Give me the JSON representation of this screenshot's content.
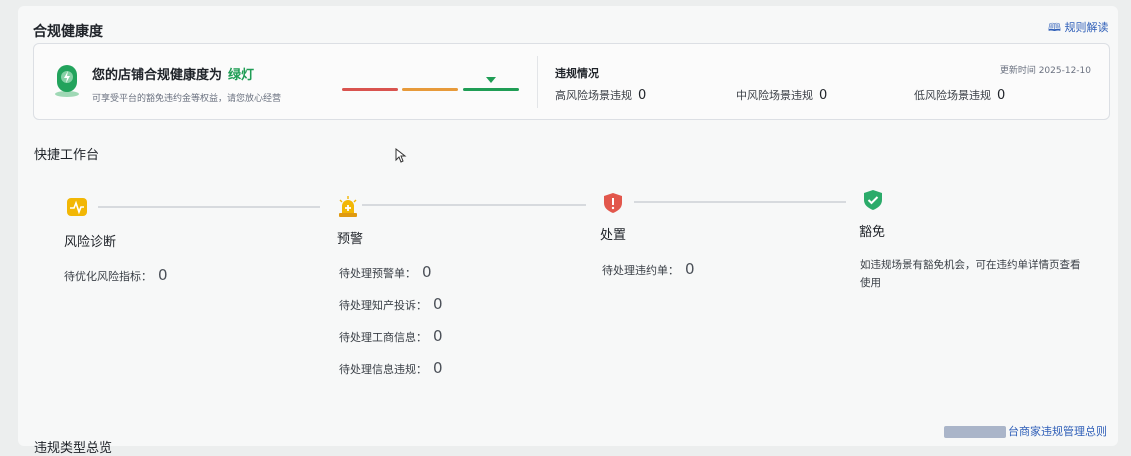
{
  "header": {
    "title": "合规健康度",
    "rules_link": "规则解读"
  },
  "health": {
    "title": "您的店铺合规健康度为",
    "value": "绿灯",
    "subtitle": "可享受平台的豁免违约金等权益，请您放心经营",
    "colors": {
      "red": "#d9534f",
      "orange": "#e79a3a",
      "green": "#1f9d55"
    }
  },
  "violations": {
    "title": "违规情况",
    "update_time": "更新时间 2025-12-10",
    "items": [
      {
        "label": "高风险场景违规",
        "value": "0"
      },
      {
        "label": "中风险场景违规",
        "value": "0"
      },
      {
        "label": "低风险场景违规",
        "value": "0"
      }
    ]
  },
  "workspace": {
    "title": "快捷工作台",
    "risk": {
      "name": "风险诊断",
      "stats": [
        {
          "label": "待优化风险指标：",
          "value": "0"
        }
      ]
    },
    "warning": {
      "name": "预警",
      "stats": [
        {
          "label": "待处理预警单：",
          "value": "0"
        },
        {
          "label": "待处理知产投诉：",
          "value": "0"
        },
        {
          "label": "待处理工商信息：",
          "value": "0"
        },
        {
          "label": "待处理信息违规：",
          "value": "0"
        }
      ]
    },
    "penalty": {
      "name": "处置",
      "stats": [
        {
          "label": "待处理违约单：",
          "value": "0"
        }
      ]
    },
    "exempt": {
      "name": "豁免",
      "description": "如违规场景有豁免机会，可在违约单详情页查看使用"
    }
  },
  "footer": {
    "section_title": "违规类型总览",
    "rules_link": "台商家违规管理总则"
  }
}
